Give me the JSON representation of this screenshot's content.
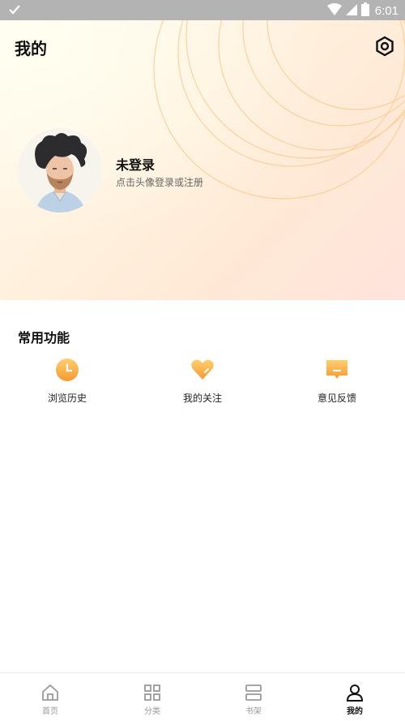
{
  "status_bar": {
    "time": "6:01"
  },
  "header": {
    "title": "我的"
  },
  "profile": {
    "name": "未登录",
    "hint": "点击头像登录或注册"
  },
  "common": {
    "title": "常用功能",
    "items": [
      {
        "label": "浏览历史",
        "icon": "clock-icon"
      },
      {
        "label": "我的关注",
        "icon": "heart-icon"
      },
      {
        "label": "意见反馈",
        "icon": "message-icon"
      }
    ]
  },
  "tabbar": {
    "items": [
      {
        "label": "首页",
        "icon": "home-icon"
      },
      {
        "label": "分类",
        "icon": "grid-icon"
      },
      {
        "label": "书架",
        "icon": "bookshelf-icon"
      },
      {
        "label": "我的",
        "icon": "user-icon"
      }
    ]
  },
  "colors": {
    "accent": "#f7a43a",
    "accent_light": "#ffc96b"
  }
}
